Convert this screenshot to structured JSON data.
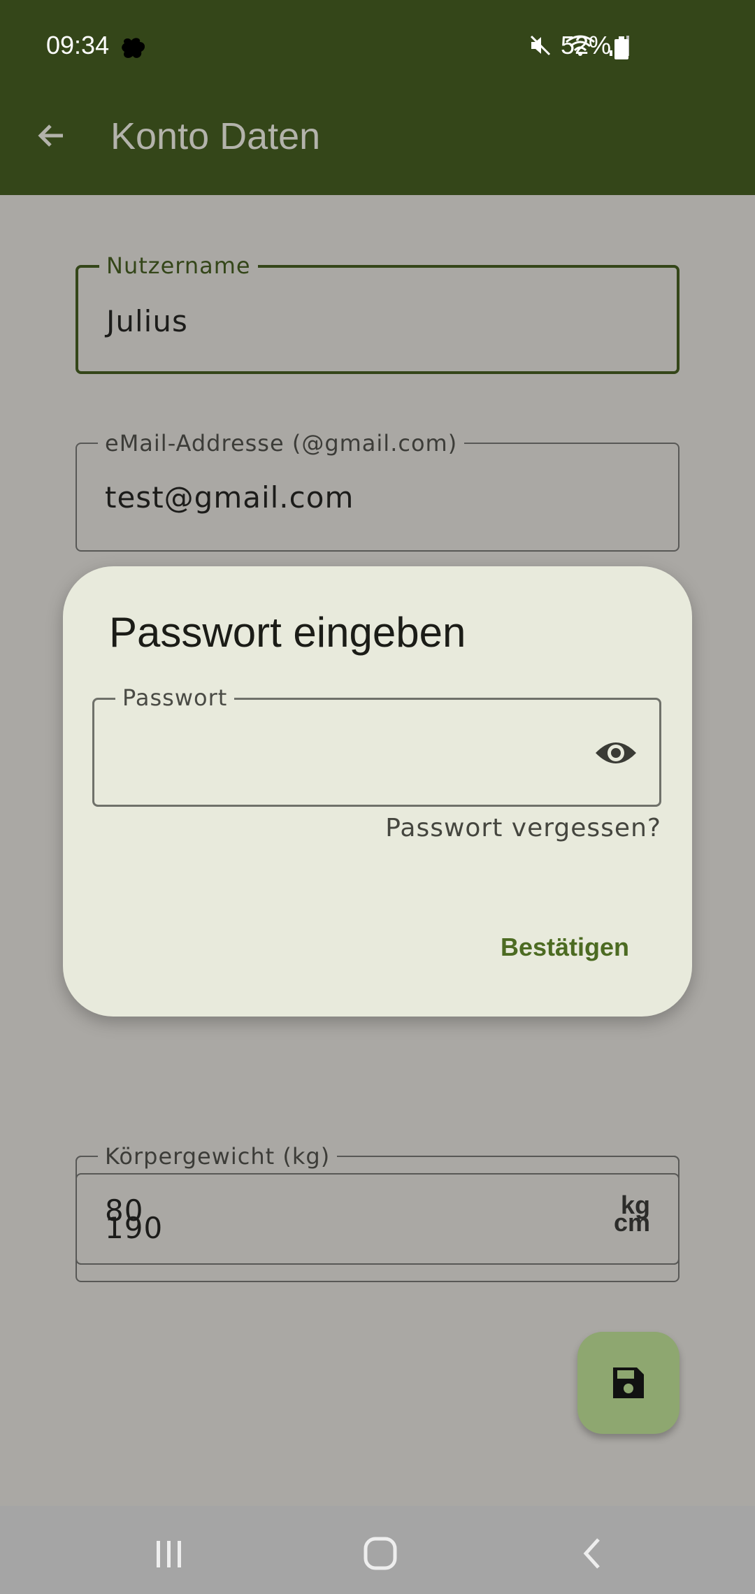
{
  "status_bar": {
    "time": "09:34",
    "battery_percent": "52%",
    "icons": [
      "mute-icon",
      "wifi-icon",
      "signal-icon",
      "battery-icon"
    ]
  },
  "app_bar": {
    "title": "Konto Daten",
    "back_icon": "arrow-back-icon"
  },
  "form": {
    "username": {
      "label": "Nutzername",
      "value": "Julius"
    },
    "email": {
      "label": "eMail-Addresse (@gmail.com)",
      "value": "test@gmail.com"
    },
    "height": {
      "value": "190",
      "suffix": "cm"
    },
    "weight": {
      "label": "Körpergewicht (kg)",
      "value": "80",
      "suffix": "kg"
    }
  },
  "fab": {
    "icon": "save-icon"
  },
  "dialog": {
    "title": "Passwort eingeben",
    "password_label": "Passwort",
    "password_value": "",
    "forgot_label": "Passwort vergessen?",
    "confirm_label": "Bestätigen"
  },
  "nav_bar": {
    "icons": [
      "recents-icon",
      "home-icon",
      "back-icon"
    ]
  },
  "colors": {
    "app_bar": "#344619",
    "scrim_background": "#aaa8a4",
    "dialog_background": "#e8eadc",
    "accent": "#4c6b22",
    "fab": "#8ea770"
  }
}
